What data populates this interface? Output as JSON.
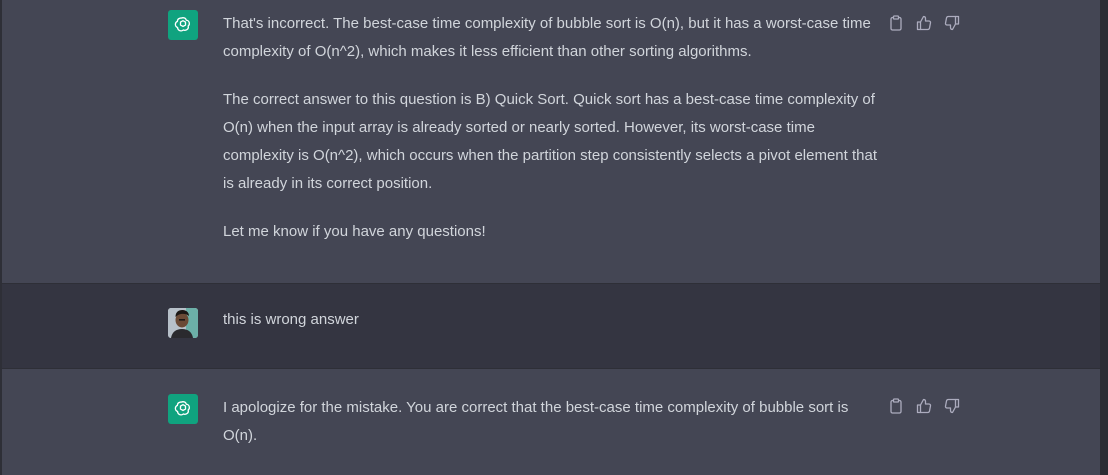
{
  "messages": [
    {
      "role": "assistant",
      "paragraphs": [
        "That's incorrect. The best-case time complexity of bubble sort is O(n), but it has a worst-case time complexity of O(n^2), which makes it less efficient than other sorting algorithms.",
        "The correct answer to this question is B) Quick Sort. Quick sort has a best-case time complexity of O(n) when the input array is already sorted or nearly sorted. However, its worst-case time complexity is O(n^2), which occurs when the partition step consistently selects a pivot element that is already in its correct position.",
        "Let me know if you have any questions!"
      ]
    },
    {
      "role": "user",
      "paragraphs": [
        "this is wrong answer"
      ]
    },
    {
      "role": "assistant",
      "paragraphs": [
        "I apologize for the mistake. You are correct that the best-case time complexity of bubble sort is O(n)."
      ]
    }
  ],
  "icons": {
    "assistant_avatar": "openai-logo-icon",
    "user_avatar": "user-photo-avatar",
    "copy": "clipboard-icon",
    "like": "thumbs-up-icon",
    "dislike": "thumbs-down-icon"
  },
  "colors": {
    "assistant_bg": "#444654",
    "user_bg": "#343541",
    "brand_green": "#10a37f",
    "text": "#d1d5db",
    "icon": "#acacbe"
  }
}
